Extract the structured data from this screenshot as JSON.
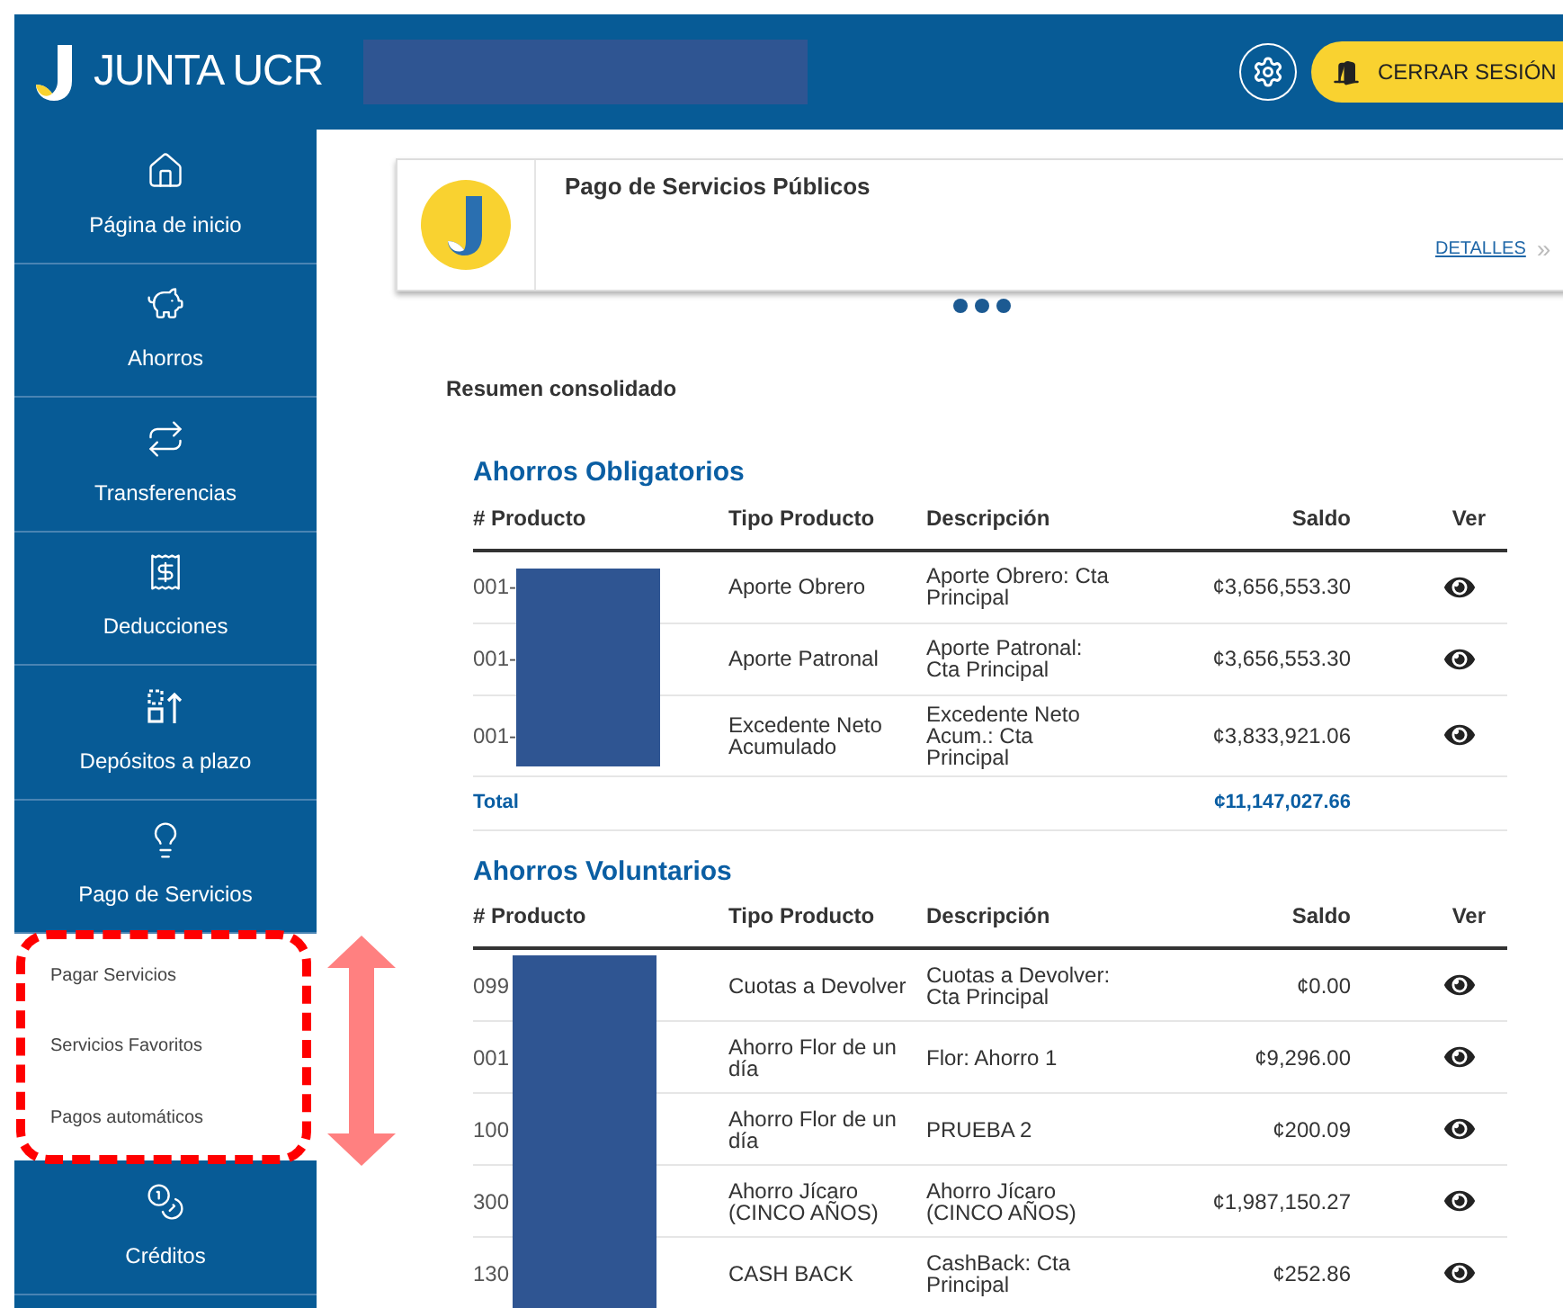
{
  "header": {
    "brand": "JUNTA UCR",
    "logout_button": "CERRAR SESIÓN"
  },
  "sidebar": {
    "items": [
      {
        "label": "Página de inicio"
      },
      {
        "label": "Ahorros"
      },
      {
        "label": "Transferencias"
      },
      {
        "label": "Deducciones"
      },
      {
        "label": "Depósitos a plazo"
      },
      {
        "label": "Pago de Servicios",
        "children": [
          {
            "label": "Pagar Servicios"
          },
          {
            "label": "Servicios Favoritos"
          },
          {
            "label": "Pagos automáticos"
          }
        ]
      },
      {
        "label": "Créditos"
      }
    ]
  },
  "banner": {
    "title": "Pago de Servicios Públicos",
    "link": "DETALLES",
    "link_arrow": "»"
  },
  "summary_title": "Resumen consolidado",
  "sections": [
    {
      "title": "Ahorros Obligatorios",
      "columns": [
        "# Producto",
        "Tipo Producto",
        "Descripción",
        "Saldo",
        "Ver"
      ],
      "rows": [
        {
          "product": "001-",
          "type": "Aporte Obrero",
          "description": "Aporte Obrero: Cta Principal",
          "balance": "¢3,656,553.30"
        },
        {
          "product": "001-",
          "type": "Aporte Patronal",
          "description": "Aporte Patronal: Cta Principal",
          "balance": "¢3,656,553.30"
        },
        {
          "product": "001-",
          "type": "Excedente Neto Acumulado",
          "description": "Excedente Neto Acum.: Cta Principal",
          "balance": "¢3,833,921.06"
        }
      ],
      "total": {
        "label": "Total",
        "value": "¢11,147,027.66"
      }
    },
    {
      "title": "Ahorros Voluntarios",
      "columns": [
        "# Producto",
        "Tipo Producto",
        "Descripción",
        "Saldo",
        "Ver"
      ],
      "rows": [
        {
          "product": "099",
          "type": "Cuotas a Devolver",
          "description": "Cuotas a Devolver: Cta Principal",
          "balance": "¢0.00"
        },
        {
          "product": "001",
          "type": "Ahorro Flor de un día",
          "description": "Flor: Ahorro 1",
          "balance": "¢9,296.00"
        },
        {
          "product": "100",
          "type": "Ahorro Flor de un día",
          "description": "PRUEBA 2",
          "balance": "¢200.09"
        },
        {
          "product": "300",
          "type": "Ahorro Jícaro (CINCO AÑOS)",
          "description": "Ahorro Jícaro (CINCO AÑOS)",
          "balance": "¢1,987,150.27"
        },
        {
          "product": "130",
          "type": "CASH BACK",
          "description": "CashBack: Cta Principal",
          "balance": "¢252.86"
        }
      ]
    }
  ]
}
